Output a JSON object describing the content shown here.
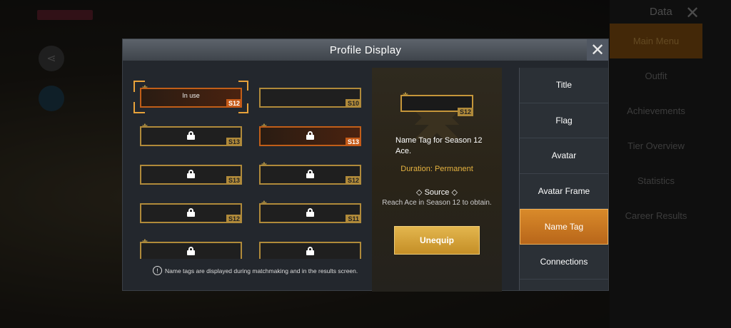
{
  "background": {
    "data_label": "Data",
    "menu": [
      "Main Menu",
      "Outfit",
      "Achievements",
      "Tier Overview",
      "Statistics",
      "Career Results"
    ],
    "active_menu": "Main Menu"
  },
  "modal": {
    "title": "Profile Display",
    "close_icon": "close-icon"
  },
  "name_tags": [
    {
      "season": "S12",
      "label": "In use",
      "locked": false,
      "style": "orange",
      "selected": true,
      "wings": true
    },
    {
      "season": "S10",
      "label": "",
      "locked": false,
      "style": "gold",
      "selected": false,
      "wings": false
    },
    {
      "season": "S13",
      "label": "",
      "locked": true,
      "style": "gold",
      "selected": false,
      "wings": true
    },
    {
      "season": "S13",
      "label": "",
      "locked": true,
      "style": "orange",
      "selected": false,
      "wings": true
    },
    {
      "season": "S13",
      "label": "",
      "locked": true,
      "style": "gold",
      "selected": false,
      "wings": false
    },
    {
      "season": "S12",
      "label": "",
      "locked": true,
      "style": "gold",
      "selected": false,
      "wings": true
    },
    {
      "season": "S12",
      "label": "",
      "locked": true,
      "style": "gold",
      "selected": false,
      "wings": false
    },
    {
      "season": "S11",
      "label": "",
      "locked": true,
      "style": "gold",
      "selected": false,
      "wings": true
    },
    {
      "season": "",
      "label": "",
      "locked": true,
      "style": "gold",
      "selected": false,
      "wings": true
    },
    {
      "season": "",
      "label": "",
      "locked": true,
      "style": "gold",
      "selected": false,
      "wings": false
    }
  ],
  "note": "Name tags are displayed during matchmaking and in the results screen.",
  "detail": {
    "preview_season": "S12",
    "name": "Name Tag for Season 12 Ace.",
    "duration": "Duration: Permanent",
    "source_heading": "Source",
    "source_text": "Reach Ace in Season 12 to obtain.",
    "button": "Unequip"
  },
  "tabs": [
    "Title",
    "Flag",
    "Avatar",
    "Avatar Frame",
    "Name Tag",
    "Connections"
  ],
  "active_tab": "Name Tag",
  "colors": {
    "accent": "#d98a2a",
    "gold": "#b08a3a",
    "duration": "#e6b340"
  }
}
